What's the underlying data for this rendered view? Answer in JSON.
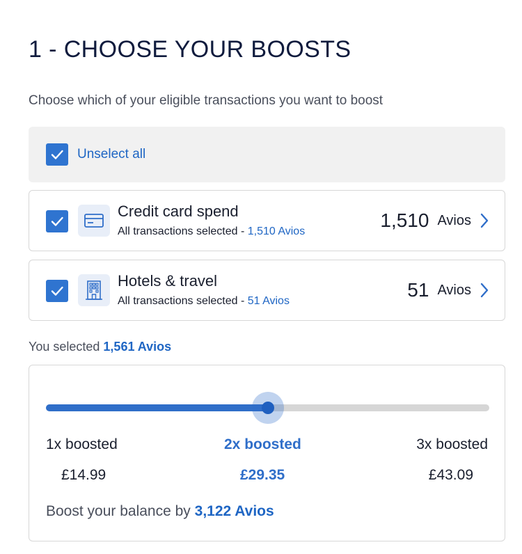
{
  "header": {
    "title": "1 - CHOOSE YOUR BOOSTS",
    "subtitle": "Choose which of your eligible transactions you want to boost"
  },
  "unselect_all": {
    "label": "Unselect all",
    "checked": true
  },
  "categories": [
    {
      "title": "Credit card spend",
      "icon": "credit-card-icon",
      "subtitle_prefix": "All transactions selected - ",
      "subtitle_value": "1,510 Avios",
      "amount": "1,510",
      "unit": "Avios",
      "checked": true
    },
    {
      "title": "Hotels & travel",
      "icon": "hotel-building-icon",
      "subtitle_prefix": "All transactions selected - ",
      "subtitle_value": "51 Avios",
      "amount": "51",
      "unit": "Avios",
      "checked": true
    }
  ],
  "selection": {
    "prefix": "You selected ",
    "value": "1,561 Avios"
  },
  "boost": {
    "slider_value_fraction": 0.5,
    "selected_index": 1,
    "options": [
      {
        "label": "1x boosted",
        "price": "£14.99"
      },
      {
        "label": "2x boosted",
        "price": "£29.35"
      },
      {
        "label": "3x boosted",
        "price": "£43.09"
      }
    ],
    "balance_prefix": "Boost your balance by ",
    "balance_value": "3,122 Avios"
  },
  "colors": {
    "accent": "#2f74d0",
    "link": "#1f66c4",
    "track": "#d6d6d6"
  }
}
